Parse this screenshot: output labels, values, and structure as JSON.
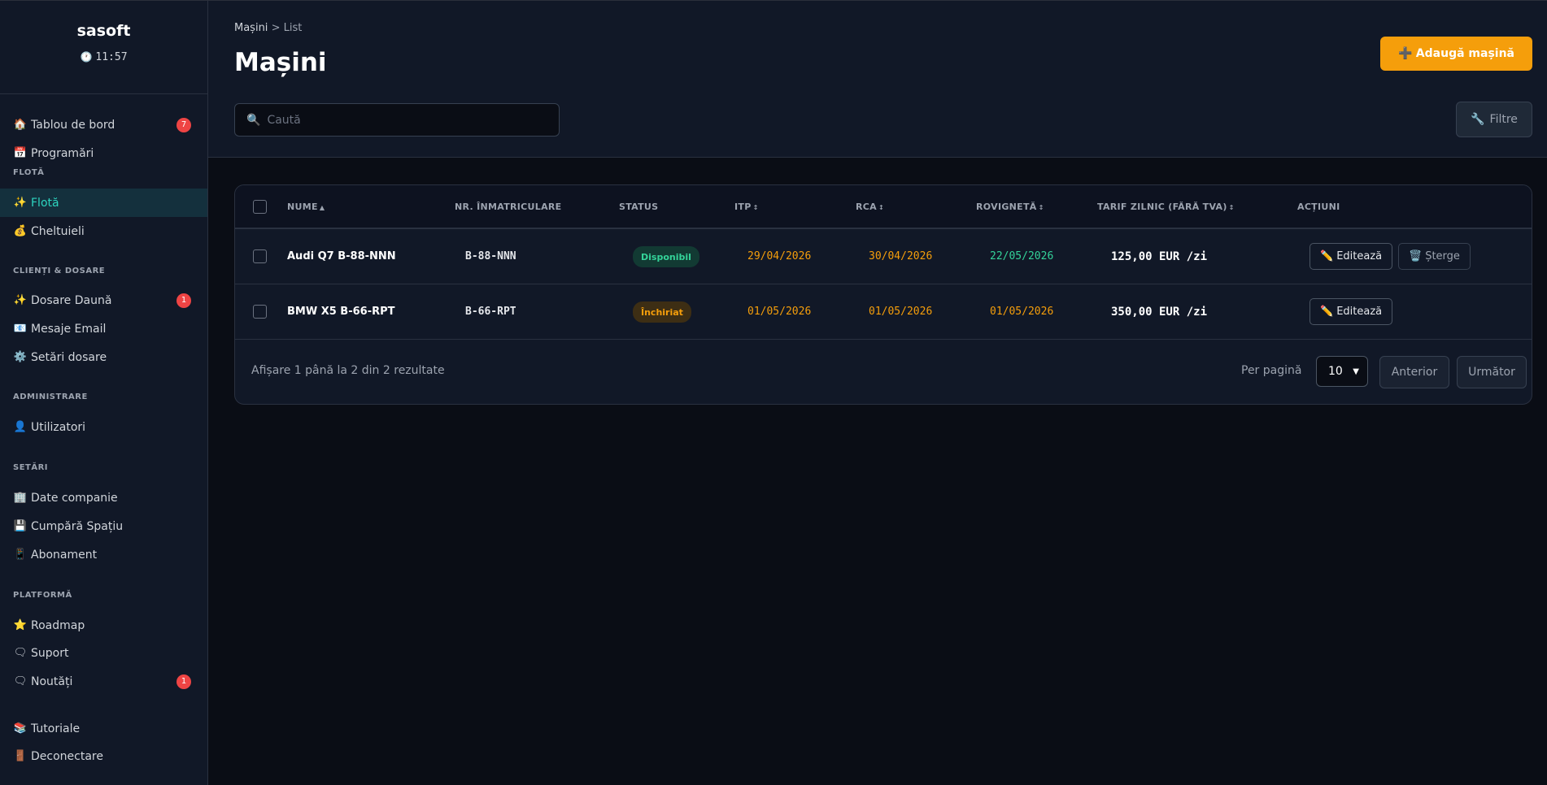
{
  "sidebar": {
    "brand": "sasoft",
    "clock_icon": "clock-icon",
    "clock": "11:57",
    "items": [
      {
        "icon": "🏠",
        "label": "Tablou de bord",
        "badge": "7"
      },
      {
        "icon": "📅",
        "label": "Programări"
      },
      {
        "icon": "✨",
        "label": "Flotă",
        "active": true
      },
      {
        "icon": "💰",
        "label": "Cheltuieli"
      },
      {
        "icon": "✨",
        "label": "Dosare Daună",
        "badge": "1"
      },
      {
        "icon": "📧",
        "label": "Mesaje Email"
      },
      {
        "icon": "⚙️",
        "label": "Setări dosare"
      },
      {
        "icon": "👤",
        "label": "Utilizatori"
      },
      {
        "icon": "🏢",
        "label": "Date companie"
      },
      {
        "icon": "💾",
        "label": "Cumpără Spațiu"
      },
      {
        "icon": "📱",
        "label": "Abonament"
      },
      {
        "icon": "⭐",
        "label": "Roadmap"
      },
      {
        "icon": "🗨",
        "label": "Suport"
      },
      {
        "icon": "🗨",
        "label": "Noutăți",
        "badge": "1"
      },
      {
        "icon": "📚",
        "label": "Tutoriale"
      },
      {
        "icon": "🚪",
        "label": "Deconectare"
      }
    ],
    "sections": [
      "FLOTĂ",
      "CLIENȚI & DOSARE",
      "ADMINISTRARE",
      "SETĂRI",
      "PLATFORMĂ"
    ]
  },
  "header": {
    "breadcrumb_root": "Mașini",
    "breadcrumb_sep": ">",
    "breadcrumb_current": "List",
    "title": "Mașini",
    "add_button": "Adaugă mașină",
    "add_icon": "➕",
    "search_placeholder": "Caută",
    "filter_label": "Filtre",
    "filter_icon": "🔧"
  },
  "table": {
    "columns": [
      "NUME",
      "NR. ÎNMATRICULARE",
      "STATUS",
      "ITP",
      "RCA",
      "ROVIGNETĂ",
      "TARIF ZILNIC (FĂRĂ TVA)",
      "ACȚIUNI"
    ],
    "sort_asc": "▲",
    "sort_both": "↕",
    "rows": [
      {
        "name": "Audi Q7 B-88-NNN",
        "plate": "B-88-NNN",
        "status": "Disponibil",
        "itp": "29/04/2026",
        "rca": "30/04/2026",
        "rovigneta": "22/05/2026",
        "tarif": "125,00 EUR /zi",
        "edit": "Editează",
        "delete": "Șterge"
      },
      {
        "name": "BMW X5 B-66-RPT",
        "plate": "B-66-RPT",
        "status": "Închiriat",
        "itp": "01/05/2026",
        "rca": "01/05/2026",
        "rovigneta": "01/05/2026",
        "tarif": "350,00 EUR /zi",
        "edit": "Editează"
      }
    ],
    "colors": {
      "available": "#34d399",
      "rented": "#f59e0b",
      "warning_date": "#f59e0b",
      "ok_date": "#34d399"
    }
  },
  "pagination": {
    "summary": "Afișare 1 până la 2 din 2 rezultate",
    "per_page_label": "Per pagină",
    "per_page_value": "10",
    "prev": "Anterior",
    "next": "Următor"
  }
}
